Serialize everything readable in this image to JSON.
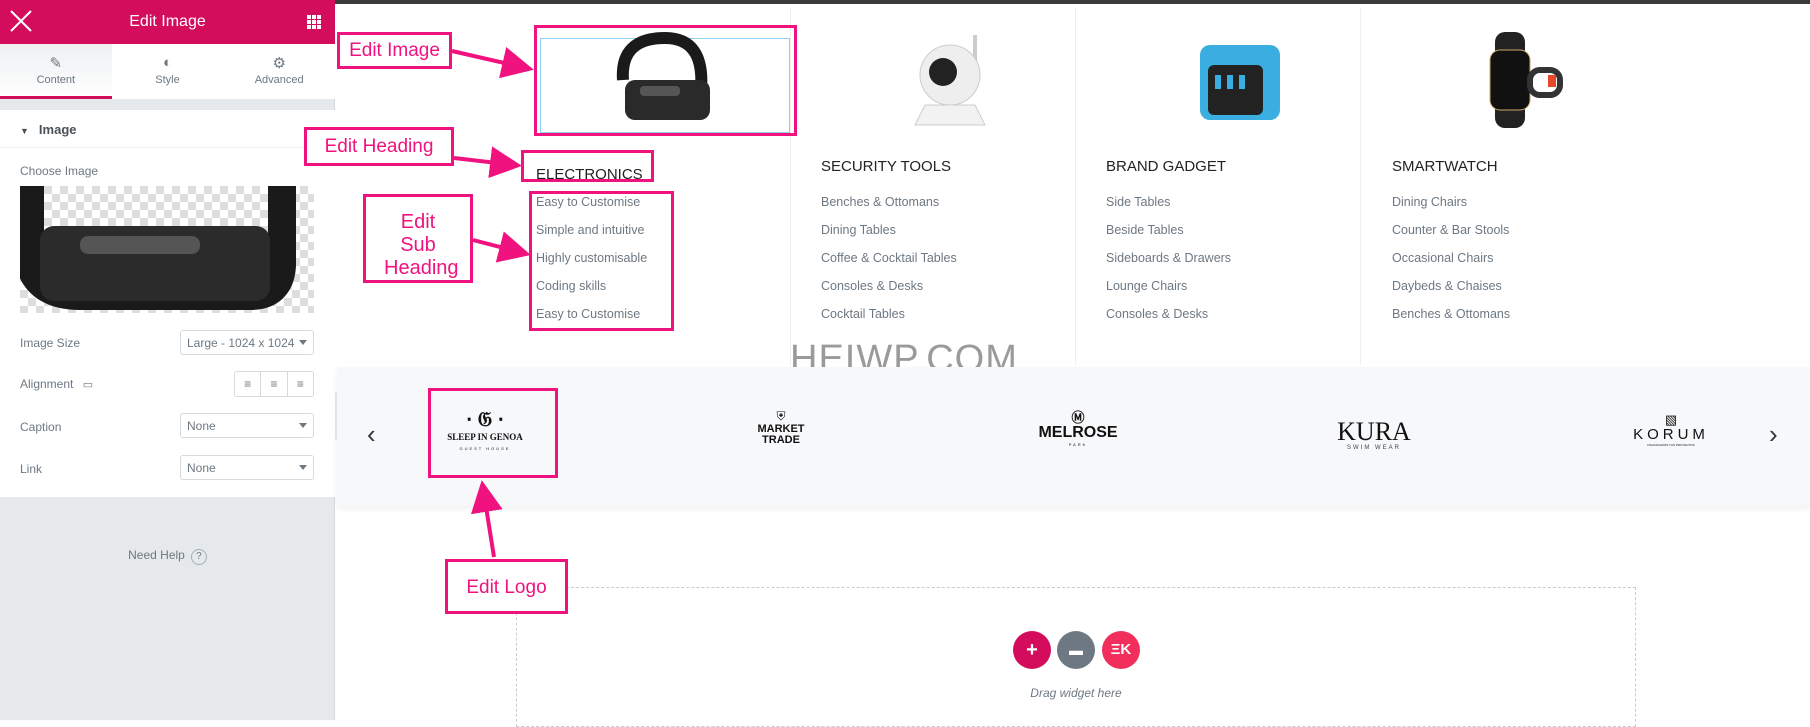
{
  "sidebar": {
    "title": "Edit Image",
    "tabs": [
      {
        "label": "Content",
        "icon": "pencil-icon",
        "active": true
      },
      {
        "label": "Style",
        "icon": "half-circle-icon",
        "active": false
      },
      {
        "label": "Advanced",
        "icon": "gear-icon",
        "active": false
      }
    ],
    "section": "Image",
    "choose_image_label": "Choose Image",
    "image_size": {
      "label": "Image Size",
      "value": "Large - 1024 x 1024"
    },
    "alignment": {
      "label": "Alignment"
    },
    "caption": {
      "label": "Caption",
      "value": "None"
    },
    "link": {
      "label": "Link",
      "value": "None"
    },
    "help": "Need Help",
    "help_icon": "?"
  },
  "menu_columns": [
    {
      "heading": "ELECTRONICS",
      "items": [
        "Easy to Customise",
        "Simple and intuitive",
        "Highly customisable",
        "Coding skills",
        "Easy to Customise"
      ]
    },
    {
      "heading": "SECURITY TOOLS",
      "items": [
        "Benches & Ottomans",
        "Dining Tables",
        "Coffee & Cocktail Tables",
        "Consoles & Desks",
        "Cocktail Tables"
      ]
    },
    {
      "heading": "BRAND GADGET",
      "items": [
        "Side Tables",
        "Beside Tables",
        "Sideboards & Drawers",
        "Lounge Chairs",
        "Consoles & Desks"
      ]
    },
    {
      "heading": "SMARTWATCH",
      "items": [
        "Dining Chairs",
        "Counter & Bar Stools",
        "Occasional Chairs",
        "Daybeds & Chaises",
        "Benches & Ottomans"
      ]
    }
  ],
  "watermark": "HEIWP.COM",
  "brands": [
    {
      "name": "SLEEP IN GENOA",
      "sub": "GUEST HOUSE"
    },
    {
      "name": "MARKET",
      "sub": "TRADE"
    },
    {
      "name": "MELROSE",
      "sub": "PARK"
    },
    {
      "name": "KURA",
      "sub": "SWIM WEAR"
    },
    {
      "name": "KORUM",
      "sub": "FINANCIAMOS TUS PROYECTOS"
    }
  ],
  "drop_zone": {
    "text": "Drag widget here"
  },
  "annotations": {
    "image": "Edit Image",
    "heading": "Edit Heading",
    "sub_heading": "Edit Sub Heading",
    "logo": "Edit Logo"
  },
  "colors": {
    "brand": "#d30c5c",
    "annotation": "#f0127e",
    "kit": "#f12e5c",
    "folder": "#6d7882"
  }
}
